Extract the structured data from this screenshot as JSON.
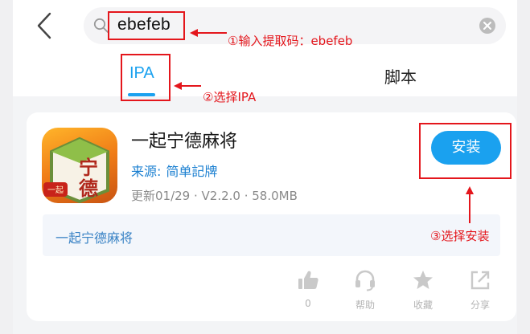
{
  "header": {
    "search_value": "ebefeb",
    "tabs": [
      {
        "label": "IPA",
        "active": true
      },
      {
        "label": "脚本",
        "active": false
      }
    ]
  },
  "app": {
    "name": "一起宁德麻将",
    "source_label": "来源:",
    "source_value": "简单記牌",
    "meta": "更新01/29 · V2.2.0 · 58.0MB",
    "install_label": "安装",
    "description": "一起宁德麻将",
    "icon_text": [
      "宁",
      "德"
    ],
    "icon_badge": "一起"
  },
  "actions": [
    {
      "icon": "thumbs-up-icon",
      "label": "0"
    },
    {
      "icon": "headset-icon",
      "label": "帮助"
    },
    {
      "icon": "star-icon",
      "label": "收藏"
    },
    {
      "icon": "share-icon",
      "label": "分享"
    }
  ],
  "annotations": {
    "step1": "①输入提取码：ebefeb",
    "step2": "②选择IPA",
    "step3": "③选择安装"
  },
  "colors": {
    "accent": "#1aa1ef",
    "annotation": "#e4161c",
    "background": "#f3f4f6"
  }
}
